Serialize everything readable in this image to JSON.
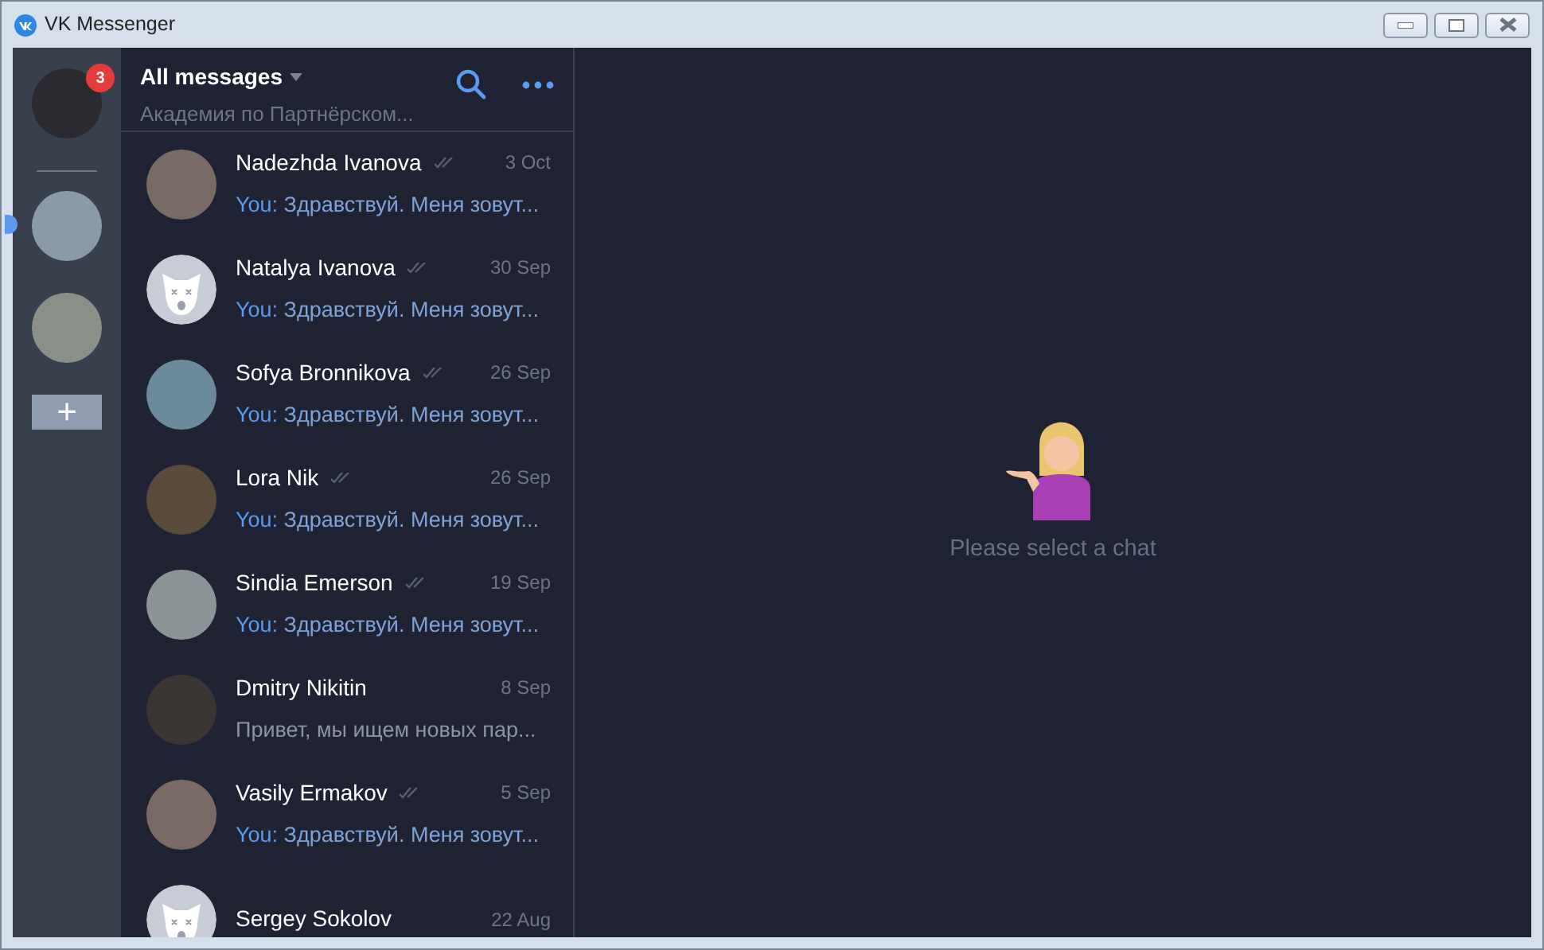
{
  "window": {
    "title": "VK Messenger"
  },
  "accounts": [
    {
      "badge": "3",
      "selected": false
    },
    {
      "selected": true
    },
    {
      "selected": false
    }
  ],
  "add_account": "+",
  "header": {
    "title": "All messages",
    "subtitle": "Академия по Партнёрском..."
  },
  "chats": [
    {
      "name": "Nadezhda Ivanova",
      "kind": "photo",
      "read_mark": true,
      "date": "3 Oct",
      "you": "You:",
      "preview": "Здравствуй. Меня зовут..."
    },
    {
      "name": "Natalya Ivanova",
      "kind": "default",
      "read_mark": true,
      "date": "30 Sep",
      "you": "You:",
      "preview": "Здравствуй. Меня зовут..."
    },
    {
      "name": "Sofya Bronnikova",
      "kind": "photo",
      "read_mark": true,
      "date": "26 Sep",
      "you": "You:",
      "preview": "Здравствуй. Меня зовут..."
    },
    {
      "name": "Lora Nik",
      "kind": "photo",
      "read_mark": true,
      "date": "26 Sep",
      "you": "You:",
      "preview": "Здравствуй. Меня зовут..."
    },
    {
      "name": "Sindia Emerson",
      "kind": "photo",
      "read_mark": true,
      "date": "19 Sep",
      "you": "You:",
      "preview": "Здравствуй. Меня зовут..."
    },
    {
      "name": "Dmitry Nikitin",
      "kind": "photo",
      "read_mark": false,
      "date": "8 Sep",
      "preview": "Привет, мы ищем новых пар..."
    },
    {
      "name": "Vasily Ermakov",
      "kind": "photo",
      "read_mark": true,
      "date": "5 Sep",
      "you": "You:",
      "preview": "Здравствуй. Меня зовут..."
    },
    {
      "name": "Sergey Sokolov",
      "kind": "default",
      "read_mark": false,
      "date": "22 Aug"
    }
  ],
  "empty_state": {
    "text": "Please select a chat"
  }
}
